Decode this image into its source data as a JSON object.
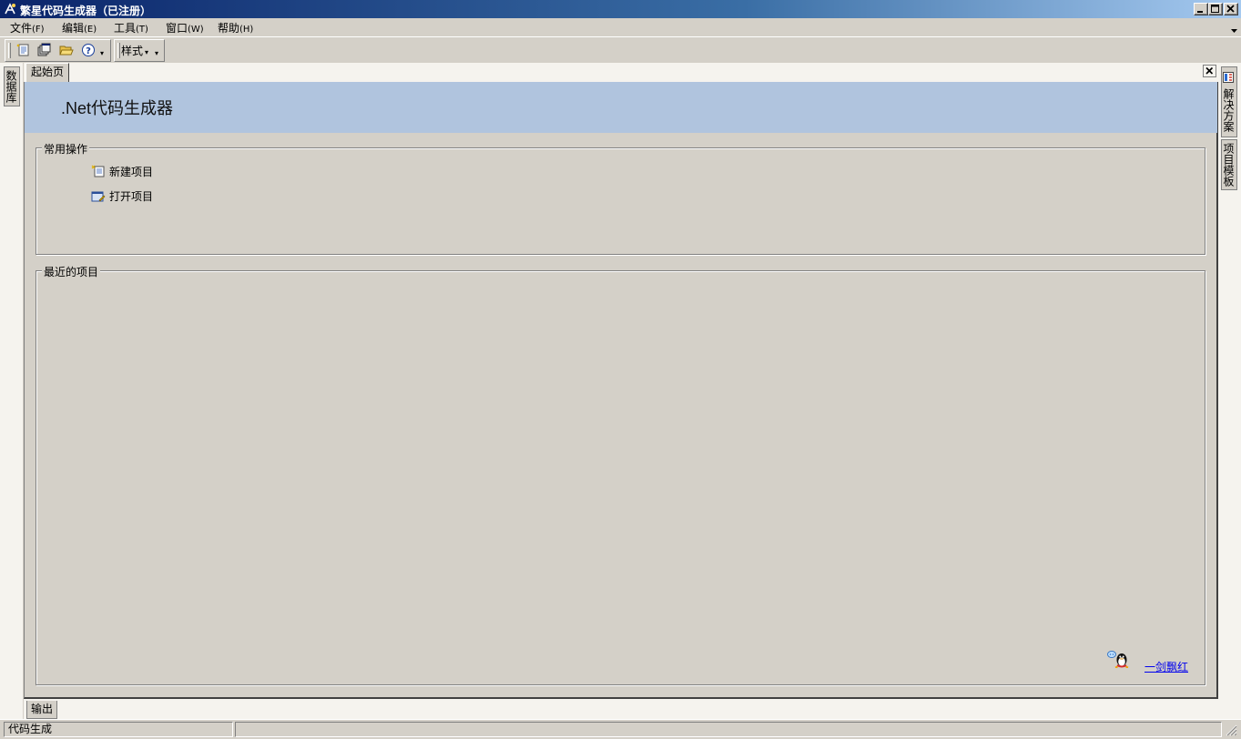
{
  "window": {
    "title": "繁星代码生成器（已注册）",
    "controls": [
      "minimize",
      "maximize",
      "close"
    ]
  },
  "menu": {
    "items": [
      {
        "label": "文件",
        "accel": "(F)"
      },
      {
        "label": "编辑",
        "accel": "(E)"
      },
      {
        "label": "工具",
        "accel": "(T)"
      },
      {
        "label": "窗口",
        "accel": "(W)"
      },
      {
        "label": "帮助",
        "accel": "(H)"
      }
    ]
  },
  "toolbar": {
    "buttons": [
      "new-project-icon",
      "copy-windows-icon",
      "open-folder-icon",
      "help-icon"
    ],
    "style_label": "样式"
  },
  "left_panel": {
    "tab_label": "数据库"
  },
  "right_panel": {
    "tabs": [
      {
        "label": "解决方案",
        "icon": "solution-icon"
      },
      {
        "label": "项目模板"
      }
    ]
  },
  "document": {
    "tab_label": "起始页",
    "banner_title": ".Net代码生成器",
    "common_ops": {
      "legend": "常用操作",
      "actions": [
        {
          "label": "新建项目",
          "icon": "new-project-icon"
        },
        {
          "label": "打开项目",
          "icon": "open-project-icon"
        }
      ]
    },
    "recent": {
      "legend": "最近的项目",
      "items": []
    },
    "author_link": "一剑飘红"
  },
  "bottom_panel": {
    "tab_label": "输出"
  },
  "status": {
    "text": "代码生成",
    "right_text": ""
  },
  "colors": {
    "titlebar_start": "#0a246a",
    "titlebar_end": "#a6caf0",
    "banner": "#b0c4de",
    "chrome": "#d4d0c8",
    "link": "#0000ee"
  }
}
